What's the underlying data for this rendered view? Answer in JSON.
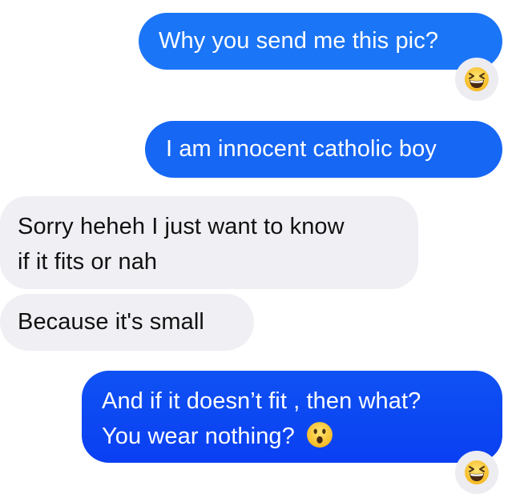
{
  "messages": [
    {
      "direction": "outgoing",
      "text": "Why you send me this pic?",
      "reaction": "laughing-squint-emoji"
    },
    {
      "direction": "outgoing",
      "text": "I am innocent catholic boy"
    },
    {
      "direction": "incoming",
      "line1": "Sorry heheh I just want to know",
      "line2": "if it fits or nah"
    },
    {
      "direction": "incoming",
      "text": "Because it's small"
    },
    {
      "direction": "outgoing",
      "line1": "And if it doesn’t fit , then what?",
      "line2": "You wear nothing?",
      "inline_emoji": "surprised-face-emoji",
      "reaction": "laughing-squint-emoji"
    }
  ],
  "colors": {
    "outgoing_top": "#1b73f6",
    "outgoing_bottom": "#0b46f2",
    "incoming": "#efeff4",
    "reaction_bg": "#ececf1",
    "emoji_yellow": "#fbd13f"
  }
}
